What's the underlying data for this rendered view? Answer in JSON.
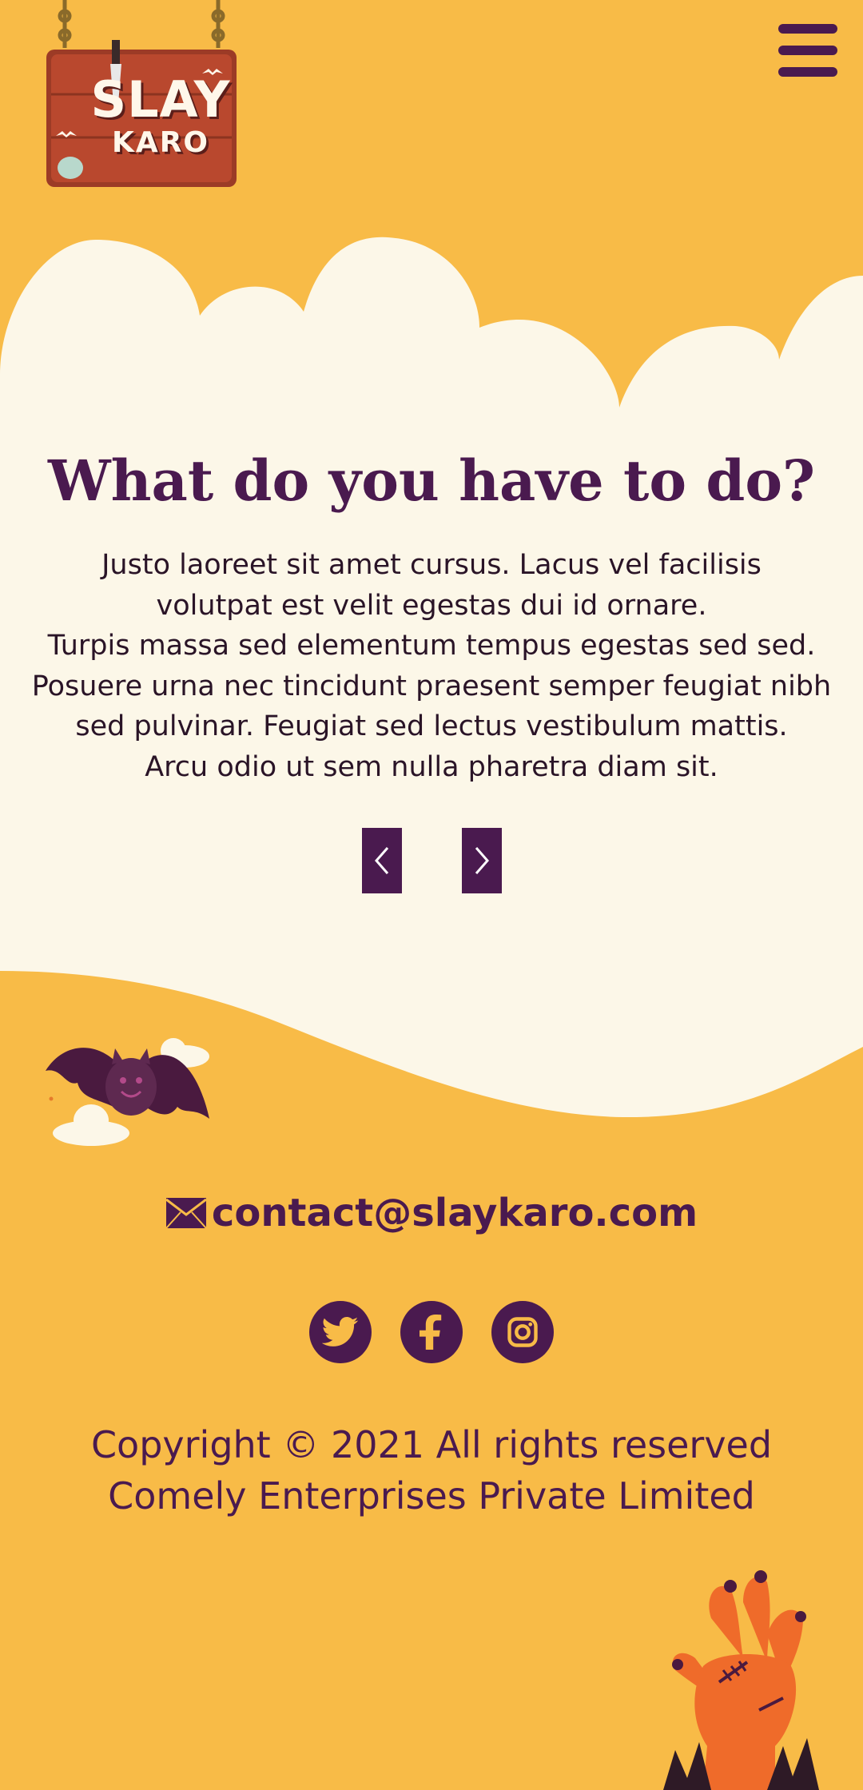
{
  "brand": {
    "line1": "SLAY",
    "line2": "KARO"
  },
  "header": {
    "menu_icon": "hamburger-menu-icon"
  },
  "main": {
    "title": "What do you have to do?",
    "paragraph_lines": [
      "Justo laoreet sit amet cursus. Lacus vel facilisis",
      "volutpat est velit egestas dui id ornare.",
      "Turpis massa sed elementum tempus egestas sed sed.",
      "Posuere urna nec tincidunt praesent semper feugiat nibh",
      "sed pulvinar. Feugiat sed lectus vestibulum mattis.",
      "Arcu odio ut sem nulla pharetra diam sit."
    ],
    "prev_icon": "chevron-left-icon",
    "next_icon": "chevron-right-icon"
  },
  "footer": {
    "email": "contact@slaykaro.com",
    "email_icon": "envelope-icon",
    "social_icons": [
      "twitter-icon",
      "facebook-icon",
      "instagram-icon"
    ],
    "copyright_line1": "Copyright © 2021 All rights reserved",
    "copyright_line2": "Comely Enterprises Private Limited"
  },
  "colors": {
    "background": "#f8bb47",
    "cloud": "#fcf7e8",
    "accent": "#4a1a4f",
    "text": "#2a1427"
  }
}
